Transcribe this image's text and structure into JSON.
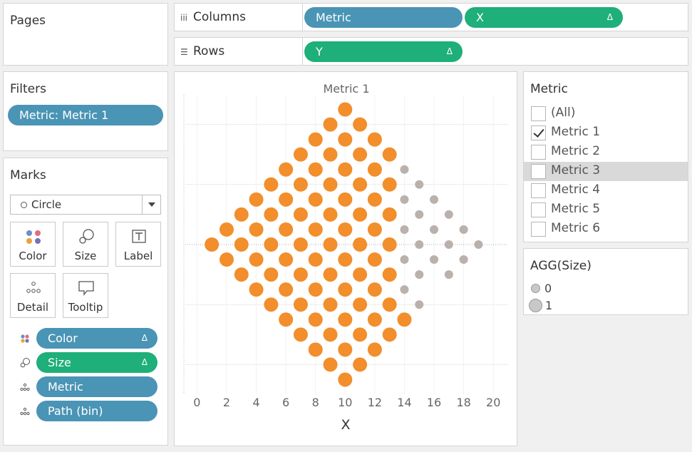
{
  "pages": {
    "title": "Pages"
  },
  "columns": {
    "label": "Columns",
    "icon": "columns-icon",
    "pills": [
      {
        "text": "Metric"
      },
      {
        "text": "X",
        "delta": "Δ"
      }
    ]
  },
  "rows": {
    "label": "Rows",
    "icon": "rows-icon",
    "pills": [
      {
        "text": "Y",
        "delta": "Δ"
      }
    ]
  },
  "filters": {
    "title": "Filters",
    "pill": "Metric: Metric 1"
  },
  "marks": {
    "title": "Marks",
    "mark_type": "Circle",
    "buttons": {
      "color": "Color",
      "size": "Size",
      "label": "Label",
      "detail": "Detail",
      "tooltip": "Tooltip"
    },
    "encodings": [
      {
        "text": "Color",
        "delta": "Δ"
      },
      {
        "text": "Size",
        "delta": "Δ"
      },
      {
        "text": "Metric"
      },
      {
        "text": "Path (bin)"
      }
    ]
  },
  "metric_filter": {
    "title": "Metric",
    "items": [
      {
        "label": "(All)",
        "checked": false
      },
      {
        "label": "Metric 1",
        "checked": true
      },
      {
        "label": "Metric 2",
        "checked": false
      },
      {
        "label": "Metric 3",
        "checked": false,
        "highlighted": true
      },
      {
        "label": "Metric 4",
        "checked": false
      },
      {
        "label": "Metric 5",
        "checked": false
      },
      {
        "label": "Metric 6",
        "checked": false
      }
    ]
  },
  "size_legend": {
    "title": "AGG(Size)",
    "items": [
      {
        "label": "0"
      },
      {
        "label": "1"
      }
    ]
  },
  "colors": {
    "orange": "#f28e2b",
    "gray": "#bab0ac",
    "blue_pill": "#4a94b5",
    "green_pill": "#1eaf7a"
  },
  "chart_data": {
    "type": "scatter",
    "title": "Metric 1",
    "xlabel": "X",
    "ylabel": "",
    "x_ticks": [
      0,
      2,
      4,
      6,
      8,
      10,
      12,
      14,
      16,
      18,
      20
    ],
    "xlim": [
      -0.5,
      21
    ],
    "ylim": [
      -9.5,
      9.5
    ],
    "grid": true,
    "series": [
      {
        "color": "orange",
        "points": [
          [
            1,
            0
          ],
          [
            2,
            1
          ],
          [
            2,
            -1
          ],
          [
            3,
            2
          ],
          [
            3,
            0
          ],
          [
            3,
            -2
          ],
          [
            4,
            3
          ],
          [
            4,
            1
          ],
          [
            4,
            -1
          ],
          [
            4,
            -3
          ],
          [
            5,
            4
          ],
          [
            5,
            2
          ],
          [
            5,
            0
          ],
          [
            5,
            -2
          ],
          [
            5,
            -4
          ],
          [
            6,
            5
          ],
          [
            6,
            3
          ],
          [
            6,
            1
          ],
          [
            6,
            -1
          ],
          [
            6,
            -3
          ],
          [
            6,
            -5
          ],
          [
            7,
            6
          ],
          [
            7,
            4
          ],
          [
            7,
            2
          ],
          [
            7,
            0
          ],
          [
            7,
            -2
          ],
          [
            7,
            -4
          ],
          [
            7,
            -6
          ],
          [
            8,
            7
          ],
          [
            8,
            5
          ],
          [
            8,
            3
          ],
          [
            8,
            1
          ],
          [
            8,
            -1
          ],
          [
            8,
            -3
          ],
          [
            8,
            -5
          ],
          [
            8,
            -7
          ],
          [
            9,
            8
          ],
          [
            9,
            6
          ],
          [
            9,
            4
          ],
          [
            9,
            2
          ],
          [
            9,
            0
          ],
          [
            9,
            -2
          ],
          [
            9,
            -4
          ],
          [
            9,
            -6
          ],
          [
            9,
            -8
          ],
          [
            10,
            9
          ],
          [
            10,
            7
          ],
          [
            10,
            5
          ],
          [
            10,
            3
          ],
          [
            10,
            1
          ],
          [
            10,
            -1
          ],
          [
            10,
            -3
          ],
          [
            10,
            -5
          ],
          [
            10,
            -7
          ],
          [
            10,
            -9
          ],
          [
            11,
            8
          ],
          [
            11,
            6
          ],
          [
            11,
            4
          ],
          [
            11,
            2
          ],
          [
            11,
            0
          ],
          [
            11,
            -2
          ],
          [
            11,
            -4
          ],
          [
            11,
            -6
          ],
          [
            11,
            -8
          ],
          [
            12,
            7
          ],
          [
            12,
            5
          ],
          [
            12,
            3
          ],
          [
            12,
            1
          ],
          [
            12,
            -1
          ],
          [
            12,
            -3
          ],
          [
            12,
            -5
          ],
          [
            12,
            -7
          ],
          [
            13,
            6
          ],
          [
            13,
            4
          ],
          [
            13,
            2
          ],
          [
            13,
            0
          ],
          [
            13,
            -2
          ],
          [
            13,
            -4
          ],
          [
            13,
            -6
          ],
          [
            14,
            -5
          ]
        ]
      },
      {
        "color": "gray",
        "points": [
          [
            14,
            5
          ],
          [
            14,
            3
          ],
          [
            14,
            1
          ],
          [
            14,
            -1
          ],
          [
            14,
            -3
          ],
          [
            15,
            4
          ],
          [
            15,
            2
          ],
          [
            15,
            0
          ],
          [
            15,
            -2
          ],
          [
            15,
            -4
          ],
          [
            16,
            3
          ],
          [
            16,
            1
          ],
          [
            16,
            -1
          ],
          [
            17,
            2
          ],
          [
            17,
            0
          ],
          [
            17,
            -2
          ],
          [
            18,
            1
          ],
          [
            18,
            -1
          ],
          [
            19,
            0
          ]
        ]
      }
    ]
  }
}
